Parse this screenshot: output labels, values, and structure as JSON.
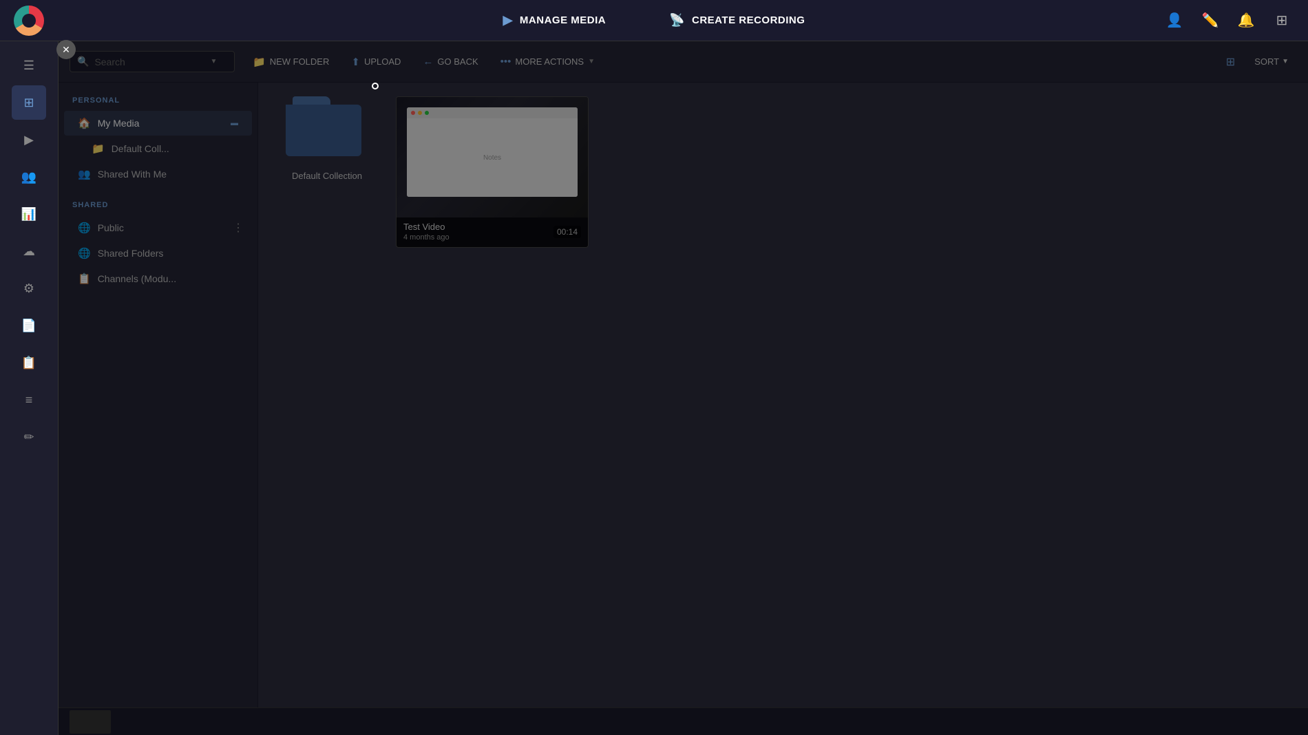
{
  "topNav": {
    "manageMedia": "MANAGE MEDIA",
    "createRecording": "CREATE RECORDING"
  },
  "toolbar": {
    "searchPlaceholder": "Search",
    "newFolderLabel": "NEW FOLDER",
    "uploadLabel": "UPLOAD",
    "goBackLabel": "GO BACK",
    "moreActionsLabel": "MORE ACTIONS",
    "sortLabel": "SORT"
  },
  "navSidebar": {
    "personalTitle": "PERSONAL",
    "myMediaLabel": "My Media",
    "defaultCollLabel": "Default Coll...",
    "sharedWithMeLabel": "Shared With Me",
    "sharedTitle": "SHARED",
    "publicLabel": "Public",
    "sharedFoldersLabel": "Shared Folders",
    "channelsLabel": "Channels (Modu..."
  },
  "mediaItems": {
    "folderName": "Default Collection",
    "videoTitle": "Test Video",
    "videoTime": "4 months ago",
    "videoDuration": "00:14",
    "windowText": "Notes"
  }
}
